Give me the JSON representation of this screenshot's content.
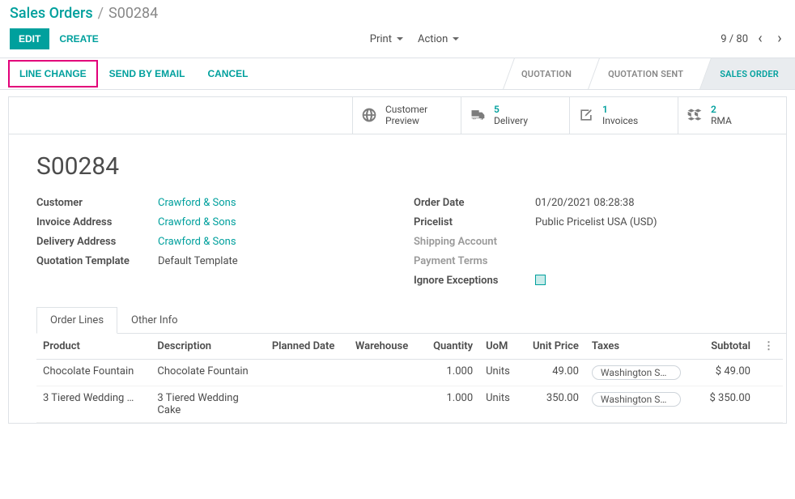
{
  "breadcrumb": {
    "root": "Sales Orders",
    "sep": "/",
    "current": "S00284"
  },
  "toolbar": {
    "edit": "EDIT",
    "create": "CREATE",
    "print": "Print",
    "action": "Action",
    "pager": "9 / 80"
  },
  "statusbar": {
    "line_change": "LINE CHANGE",
    "send_by_email": "SEND BY EMAIL",
    "cancel": "CANCEL",
    "stages": {
      "quotation": "QUOTATION",
      "quotation_sent": "QUOTATION SENT",
      "sales_order": "SALES ORDER"
    }
  },
  "stats": {
    "customer_preview": {
      "label_top": "Customer",
      "label_bottom": "Preview"
    },
    "delivery": {
      "count": "5",
      "label": "Delivery"
    },
    "invoices": {
      "count": "1",
      "label": "Invoices"
    },
    "rma": {
      "count": "2",
      "label": "RMA"
    }
  },
  "order_name": "S00284",
  "fields": {
    "customer": {
      "label": "Customer",
      "value": "Crawford & Sons"
    },
    "invoice_address": {
      "label": "Invoice Address",
      "value": "Crawford & Sons"
    },
    "delivery_address": {
      "label": "Delivery Address",
      "value": "Crawford & Sons"
    },
    "quotation_template": {
      "label": "Quotation Template",
      "value": "Default Template"
    },
    "order_date": {
      "label": "Order Date",
      "value": "01/20/2021 08:28:38"
    },
    "pricelist": {
      "label": "Pricelist",
      "value": "Public Pricelist USA (USD)"
    },
    "shipping_account": {
      "label": "Shipping Account",
      "value": ""
    },
    "payment_terms": {
      "label": "Payment Terms",
      "value": ""
    },
    "ignore_exceptions": {
      "label": "Ignore Exceptions"
    }
  },
  "tabs": {
    "order_lines": "Order Lines",
    "other_info": "Other Info"
  },
  "columns": {
    "product": "Product",
    "description": "Description",
    "planned_date": "Planned Date",
    "warehouse": "Warehouse",
    "quantity": "Quantity",
    "uom": "UoM",
    "unit_price": "Unit Price",
    "taxes": "Taxes",
    "subtotal": "Subtotal"
  },
  "lines": [
    {
      "product": "Chocolate Fountain",
      "description": "Chocolate Fountain",
      "planned_date": "",
      "warehouse": "",
      "quantity": "1.000",
      "uom": "Units",
      "unit_price": "49.00",
      "taxes": "Washington Sale…",
      "subtotal": "$ 49.00"
    },
    {
      "product": "3 Tiered Wedding …",
      "description": "3 Tiered Wedding Cake",
      "planned_date": "",
      "warehouse": "",
      "quantity": "1.000",
      "uom": "Units",
      "unit_price": "350.00",
      "taxes": "Washington Sale…",
      "subtotal": "$ 350.00"
    }
  ]
}
